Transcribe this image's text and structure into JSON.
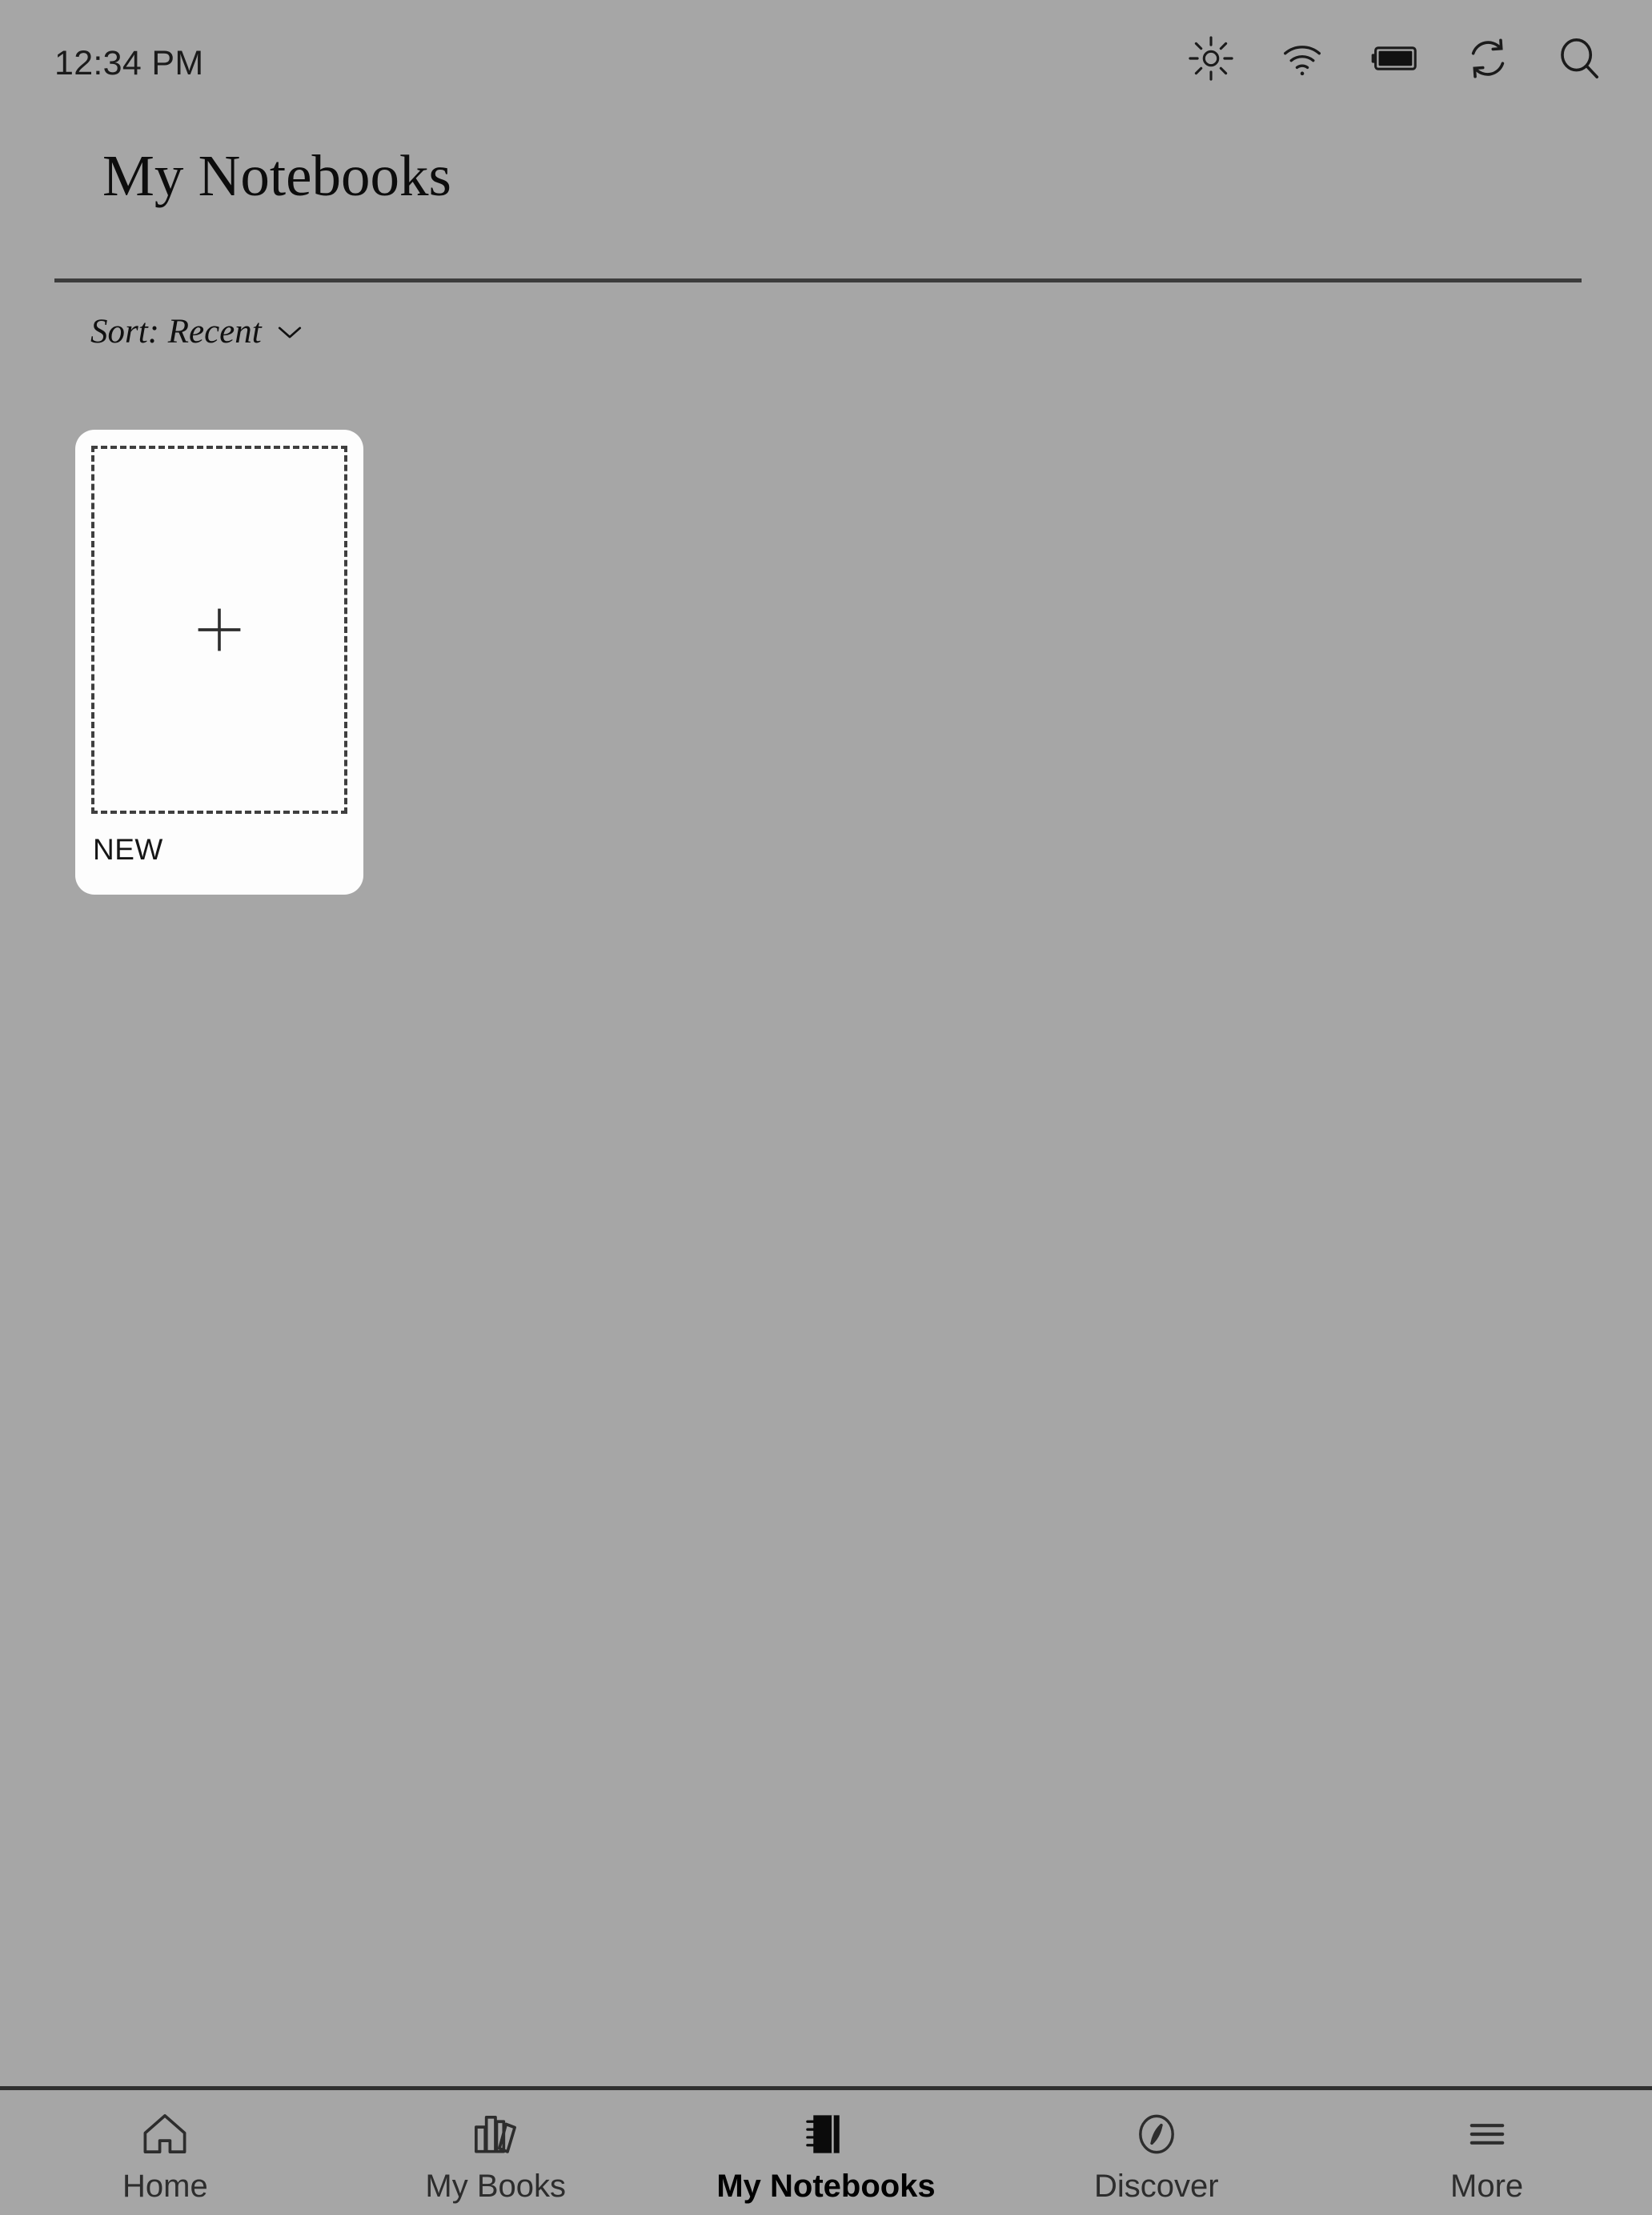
{
  "status_bar": {
    "time": "12:34 PM",
    "icons": [
      {
        "name": "brightness-icon",
        "label": "Brightness"
      },
      {
        "name": "wifi-icon",
        "label": "Wi-Fi"
      },
      {
        "name": "battery-icon",
        "label": "Battery"
      },
      {
        "name": "sync-icon",
        "label": "Sync"
      },
      {
        "name": "search-icon",
        "label": "Search"
      }
    ]
  },
  "header": {
    "title": "My Notebooks"
  },
  "sort": {
    "label": "Sort: Recent",
    "chevron": "chevron-down-icon"
  },
  "notebooks": [
    {
      "label": "NEW",
      "type": "new-notebook",
      "icon": "plus-icon"
    }
  ],
  "bottom_nav": {
    "items": [
      {
        "label": "Home",
        "icon": "home-icon",
        "active": false
      },
      {
        "label": "My Books",
        "icon": "books-icon",
        "active": false
      },
      {
        "label": "My Notebooks",
        "icon": "notebook-icon",
        "active": true
      },
      {
        "label": "Discover",
        "icon": "compass-icon",
        "active": false
      },
      {
        "label": "More",
        "icon": "hamburger-menu-icon",
        "active": false
      }
    ]
  },
  "colors": {
    "background": "#a6a6a6",
    "card": "#fdfdfd",
    "ink": "#111111",
    "rule": "#3c3c3c"
  }
}
